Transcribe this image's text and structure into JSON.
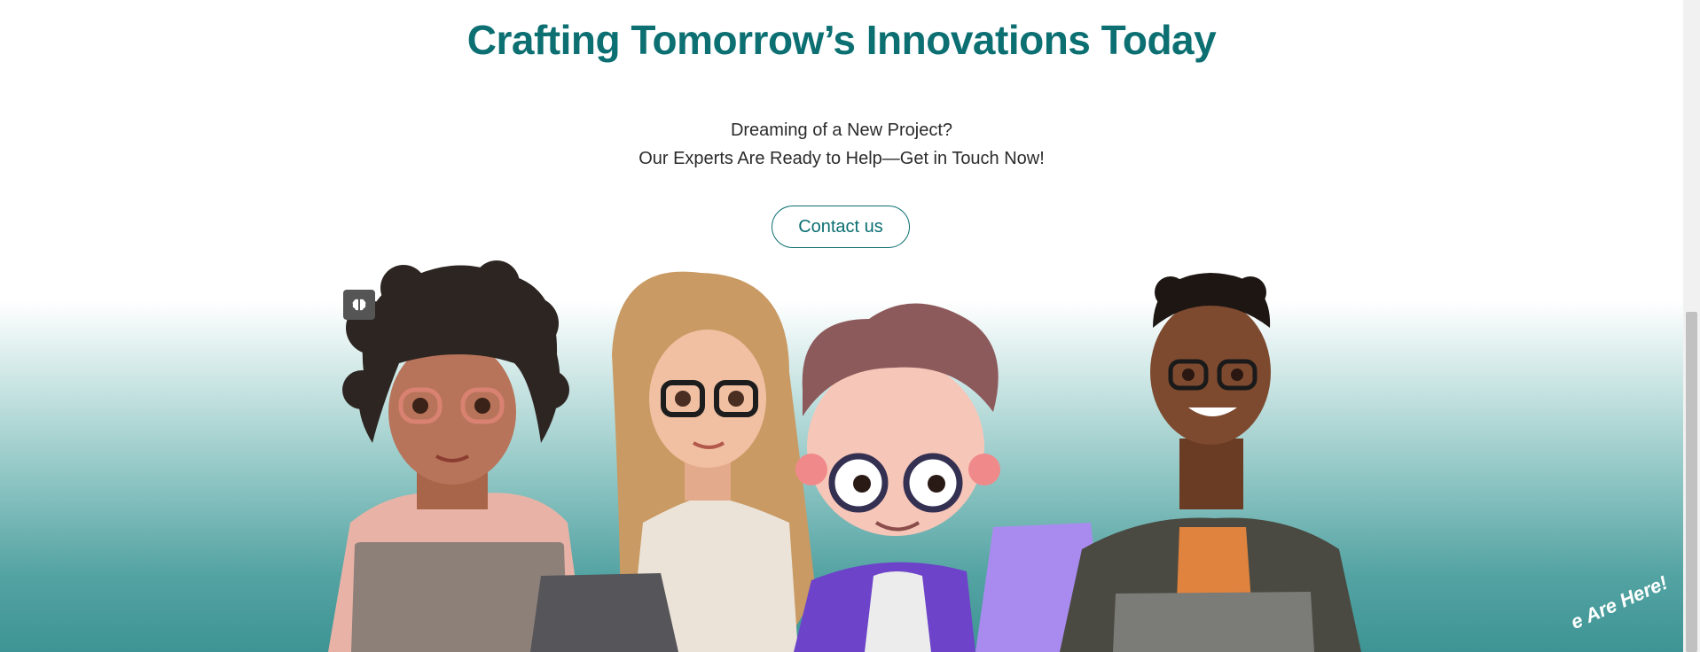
{
  "hero": {
    "title": "Crafting Tomorrow’s Innovations Today",
    "subtitle_line1": "Dreaming of a New Project?",
    "subtitle_line2": "Our Experts Are Ready to Help—Get in Touch Now!",
    "cta_label": "Contact us"
  },
  "corner_badge": {
    "text": "e Are Here!"
  },
  "widget": {
    "icon": "brain-icon"
  },
  "colors": {
    "brand_teal": "#0c6f72",
    "gradient_bottom": "#3e9494"
  }
}
